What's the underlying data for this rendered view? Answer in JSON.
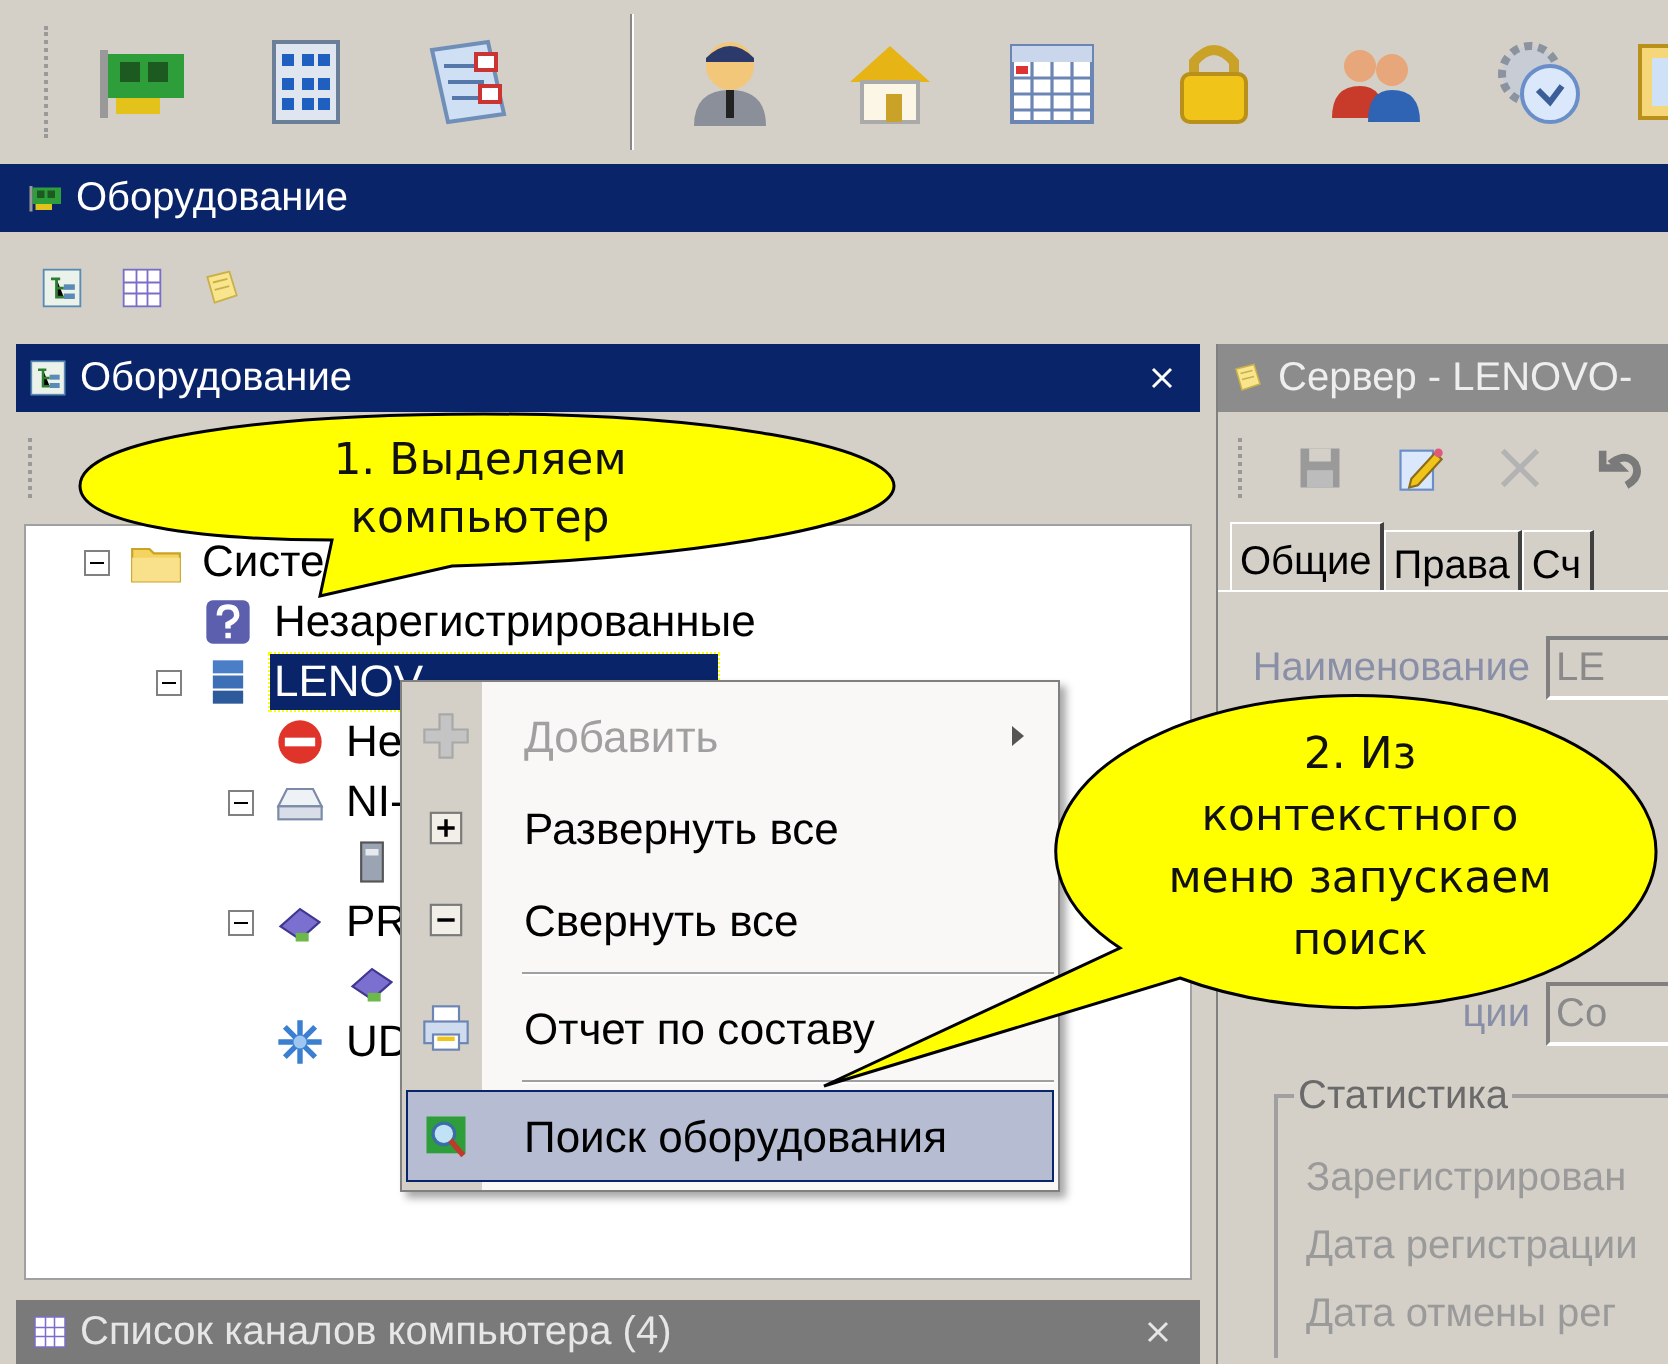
{
  "window": {
    "title": "Оборудование"
  },
  "equipment_panel": {
    "title": "Оборудование",
    "tree": [
      {
        "kind": "folder",
        "label": "Систе",
        "expanded": true,
        "selected": false,
        "children": [
          {
            "kind": "unregistered",
            "label": "Незарегистрированные",
            "selected": false
          },
          {
            "kind": "computer",
            "label": "LENOV",
            "expanded": true,
            "selected": true,
            "children": [
              {
                "kind": "stop",
                "label": "Не",
                "selected": false
              },
              {
                "kind": "drive",
                "label": "NI-",
                "expanded": true,
                "selected": false,
                "children": [
                  {
                    "kind": "device",
                    "selected": false
                  }
                ]
              },
              {
                "kind": "usb",
                "label": "PR",
                "expanded": true,
                "selected": false,
                "children": [
                  {
                    "kind": "usb",
                    "selected": false
                  }
                ]
              },
              {
                "kind": "network",
                "label": "UD",
                "selected": false
              }
            ]
          }
        ]
      }
    ]
  },
  "context_menu": [
    {
      "kind": "item",
      "label": "Добавить",
      "disabled": true,
      "submenu": true,
      "selected": false
    },
    {
      "kind": "item",
      "label": "Развернуть все",
      "disabled": false,
      "submenu": false,
      "selected": false
    },
    {
      "kind": "item",
      "label": "Свернуть все",
      "disabled": false,
      "submenu": false,
      "selected": false
    },
    {
      "kind": "separator"
    },
    {
      "kind": "item",
      "label": "Отчет по составу",
      "disabled": false,
      "submenu": false,
      "selected": false
    },
    {
      "kind": "separator"
    },
    {
      "kind": "item",
      "label": "Поиск оборудования",
      "disabled": false,
      "submenu": false,
      "selected": true
    }
  ],
  "server_panel": {
    "title": "Сервер - LENOVO-",
    "tabs": [
      {
        "label": "Общие",
        "selected": true
      },
      {
        "label": "Права",
        "selected": false
      },
      {
        "label": "Сч",
        "selected": false
      }
    ],
    "fields": [
      {
        "label": "Наименование",
        "value": "LE"
      },
      {
        "label": "ции",
        "value": "Co"
      }
    ],
    "statistics": {
      "title": "Статистика",
      "rows": [
        "Зарегистрирован",
        "Дата регистрации",
        "Дата отмены рег"
      ]
    }
  },
  "channels_panel": {
    "title": "Список каналов компьютера (4)"
  },
  "callouts": [
    {
      "lines": [
        "1. Выделяем",
        "компьютер"
      ]
    },
    {
      "lines": [
        "2. Из",
        "контекстного",
        "меню запускаем",
        "поиск"
      ]
    }
  ]
}
